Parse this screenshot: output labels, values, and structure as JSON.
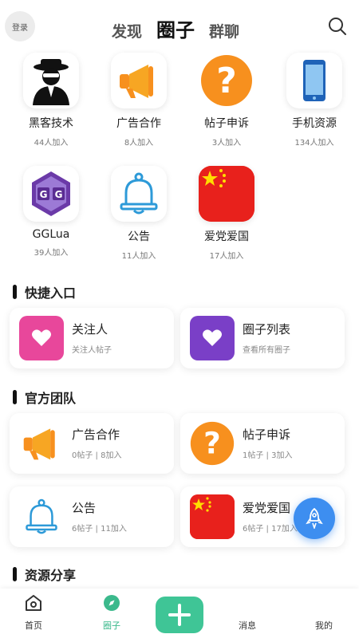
{
  "header": {
    "login": "登录",
    "tabs": [
      "发现",
      "圈子",
      "群聊"
    ],
    "active_tab": "圈子"
  },
  "circles": [
    {
      "name": "黑客技术",
      "count": "44人加入",
      "icon": "hacker-icon"
    },
    {
      "name": "广告合作",
      "count": "8人加入",
      "icon": "megaphone-icon"
    },
    {
      "name": "帖子申诉",
      "count": "3人加入",
      "icon": "question-icon"
    },
    {
      "name": "手机资源",
      "count": "134人加入",
      "icon": "phone-icon"
    },
    {
      "name": "GGLua",
      "count": "39人加入",
      "icon": "gg-icon"
    },
    {
      "name": "公告",
      "count": "11人加入",
      "icon": "bell-icon"
    },
    {
      "name": "爱党爱国",
      "count": "17人加入",
      "icon": "china-flag-icon"
    }
  ],
  "quick": {
    "title": "快捷入口",
    "items": [
      {
        "title": "关注人",
        "sub": "关注人帖子",
        "color": "#e8479b"
      },
      {
        "title": "圈子列表",
        "sub": "查看所有圈子",
        "color": "#7a3fc7"
      }
    ]
  },
  "official": {
    "title": "官方团队",
    "items": [
      {
        "title": "广告合作",
        "sub": "0帖子 | 8加入"
      },
      {
        "title": "帖子申诉",
        "sub": "1帖子 | 3加入"
      },
      {
        "title": "公告",
        "sub": "6帖子 | 11加入"
      },
      {
        "title": "爱党爱国",
        "sub": "6帖子 | 17加入"
      }
    ]
  },
  "resources": {
    "title": "资源分享"
  },
  "bottom_nav": [
    "首页",
    "圈子",
    "消息",
    "我的"
  ],
  "colors": {
    "accent": "#3fc596",
    "fab": "#3d8ef0",
    "orange": "#f7901e",
    "flag_red": "#e8211c"
  }
}
